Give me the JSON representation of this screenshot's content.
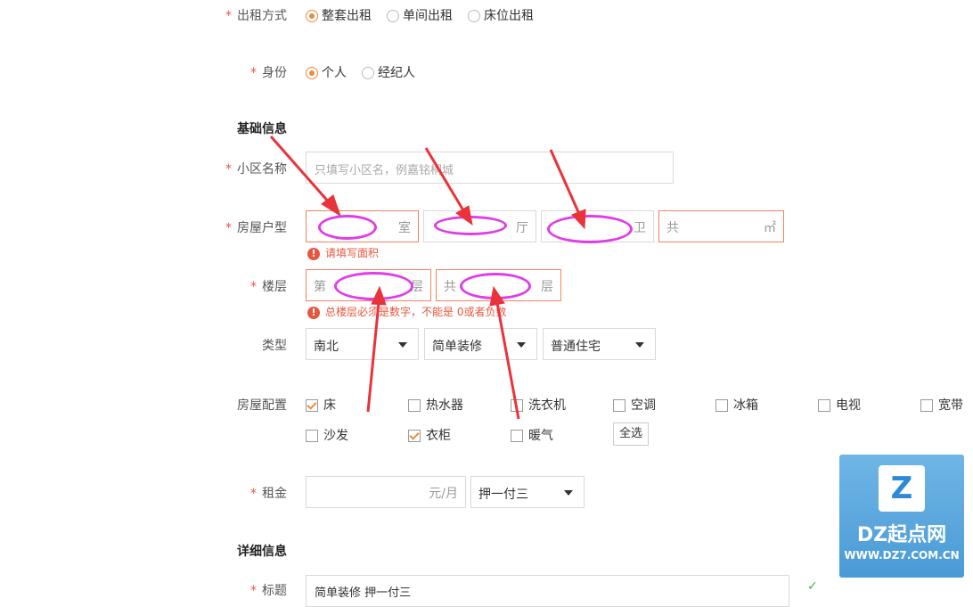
{
  "rent_mode": {
    "label": "出租方式",
    "options": [
      "整套出租",
      "单间出租",
      "床位出租"
    ],
    "selected": 0
  },
  "identity": {
    "label": "身份",
    "options": [
      "个人",
      "经纪人"
    ],
    "selected": 0
  },
  "basic_section": {
    "title": "基础信息"
  },
  "community": {
    "label": "小区名称",
    "placeholder": "只填写小区名，例嘉铭桐城"
  },
  "layout": {
    "label": "房屋户型",
    "room_suffix": "室",
    "hall_suffix": "厅",
    "bath_suffix": "卫",
    "area_prefix": "共",
    "area_suffix": "㎡",
    "error": "请填写面积"
  },
  "floor": {
    "label": "楼层",
    "floor_prefix": "第",
    "floor_suffix": "层",
    "total_prefix": "共",
    "total_suffix": "层",
    "error": "总楼层必须是数字，不能是 0或者负数"
  },
  "type": {
    "label": "类型",
    "orientation": "南北",
    "decoration": "简单装修",
    "house_kind": "普通住宅"
  },
  "config": {
    "label": "房屋配置",
    "items": [
      {
        "name": "床",
        "checked": true
      },
      {
        "name": "热水器",
        "checked": false
      },
      {
        "name": "洗衣机",
        "checked": false
      },
      {
        "name": "空调",
        "checked": false
      },
      {
        "name": "冰箱",
        "checked": false
      },
      {
        "name": "电视",
        "checked": false
      },
      {
        "name": "宽带",
        "checked": false
      },
      {
        "name": "沙发",
        "checked": false
      },
      {
        "name": "衣柜",
        "checked": true
      },
      {
        "name": "暖气",
        "checked": false
      }
    ],
    "select_all": "全选"
  },
  "rent": {
    "label": "租金",
    "unit": "元/月",
    "payment": "押一付三"
  },
  "detail_section": {
    "title": "详细信息"
  },
  "title_field": {
    "label": "标题",
    "value": "简单装修 押一付三"
  },
  "watermark": {
    "logo": "Z",
    "name": "DZ起点网",
    "url": "WWW.DZ7.COM.CN"
  },
  "colors": {
    "accent": "#f08a3a",
    "error": "#e8563f",
    "annotation": "#e03ce8",
    "arrow": "#e8333b"
  }
}
